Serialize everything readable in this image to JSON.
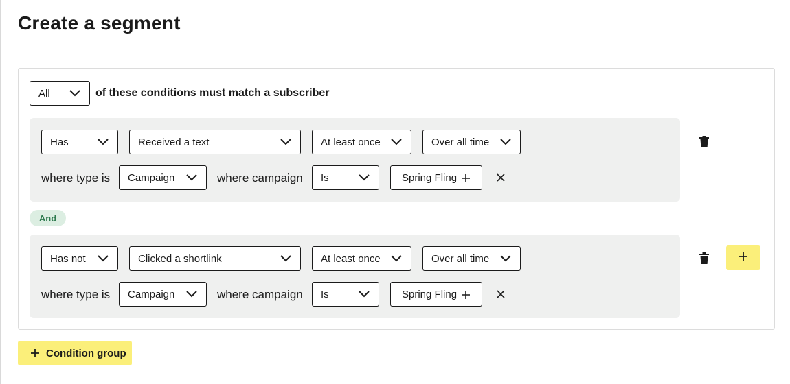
{
  "page": {
    "title": "Create a segment"
  },
  "match": {
    "quantifier": "All",
    "label": "of these conditions must match a subscriber"
  },
  "connector_label": "And",
  "groups": [
    {
      "presence": "Has",
      "event": "Received a text",
      "frequency": "At least once",
      "timeframe": "Over all time",
      "type_label": "where type is",
      "type_value": "Campaign",
      "campaign_label": "where campaign",
      "campaign_operator": "Is",
      "campaign_value": "Spring Fling"
    },
    {
      "presence": "Has not",
      "event": "Clicked a shortlink",
      "frequency": "At least once",
      "timeframe": "Over all time",
      "type_label": "where type is",
      "type_value": "Campaign",
      "campaign_label": "where campaign",
      "campaign_operator": "Is",
      "campaign_value": "Spring Fling"
    }
  ],
  "footer": {
    "add_group_label": "Condition group"
  },
  "icons": {
    "dropdown": "chevron-down-icon",
    "add": "plus-icon",
    "remove": "close-icon",
    "delete": "trash-icon"
  },
  "colors": {
    "accent_yellow": "#fbef7a",
    "group_bg": "#eff0ef",
    "and_pill_bg": "#dceee2",
    "and_pill_text": "#2e7b4f"
  }
}
